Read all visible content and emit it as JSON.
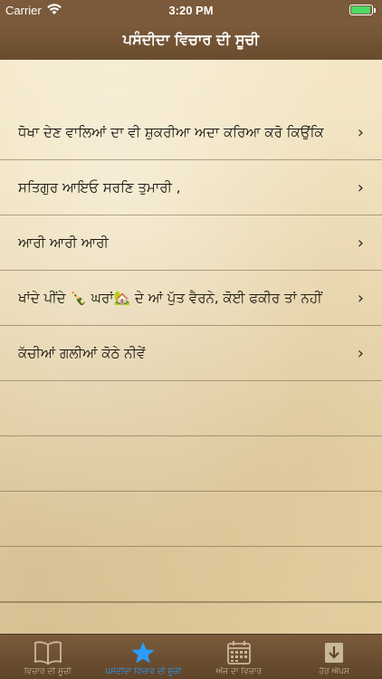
{
  "status_bar": {
    "carrier": "Carrier",
    "time": "3:20 PM",
    "battery_color": "#4cd964"
  },
  "nav": {
    "title": "ਪਸੰਦੀਦਾ ਵਿਚਾਰ ਦੀ ਸੂਚੀ"
  },
  "list": {
    "items": [
      {
        "label": "ਧੋਖਾ ਦੇਣ ਵਾਲਿਆਂ ਦਾ ਵੀ ਸ਼ੁਕਰੀਆ ਅਦਾ ਕਰਿਆ ਕਰੋ ਕਿਉਂਕਿ",
        "chevron": "›"
      },
      {
        "label": "ਸਤਿਗੁਰ ਆਇਓ ਸਰਣਿ ਤੁਮਾਰੀ ,",
        "chevron": "›"
      },
      {
        "label": "ਆਰੀ ਆਰੀ ਆਰੀ",
        "chevron": "›"
      },
      {
        "label": "ਖਾਂਦੇ ਪੀਂਦੇ 🍾 ਘਰਾਂ🏡 ਦੇ ਆਂ ਪੁੱਤ ਵੈਰਨੇ, ਕੋਈ ਫਕੀਰ ਤਾਂ ਨਹੀਂ",
        "chevron": "›"
      },
      {
        "label": "ਕੱਚੀਆਂ ਗਲੀਆਂ ਕੋਠੇ ਨੀਵੇਂ",
        "chevron": "›"
      }
    ],
    "empty_row_count": 5
  },
  "tab_bar": {
    "tabs": [
      {
        "label": "ਵਿਚਾਰ ਦੀ ਸੂਚੀ",
        "icon": "book-icon",
        "active": false
      },
      {
        "label": "ਪਸੰਦੀਦਾ ਵਿਚਾਰ ਦੀ ਸੂਚੀ",
        "icon": "star-icon",
        "active": true
      },
      {
        "label": "ਅੱਜ ਦਾ ਵਿਚਾਰ",
        "icon": "calendar-icon",
        "active": false
      },
      {
        "label": "ਹੋਰ ਐਪਸ",
        "icon": "download-icon",
        "active": false
      }
    ],
    "active_color": "#2a9dff",
    "inactive_color": "#c9b79a"
  }
}
